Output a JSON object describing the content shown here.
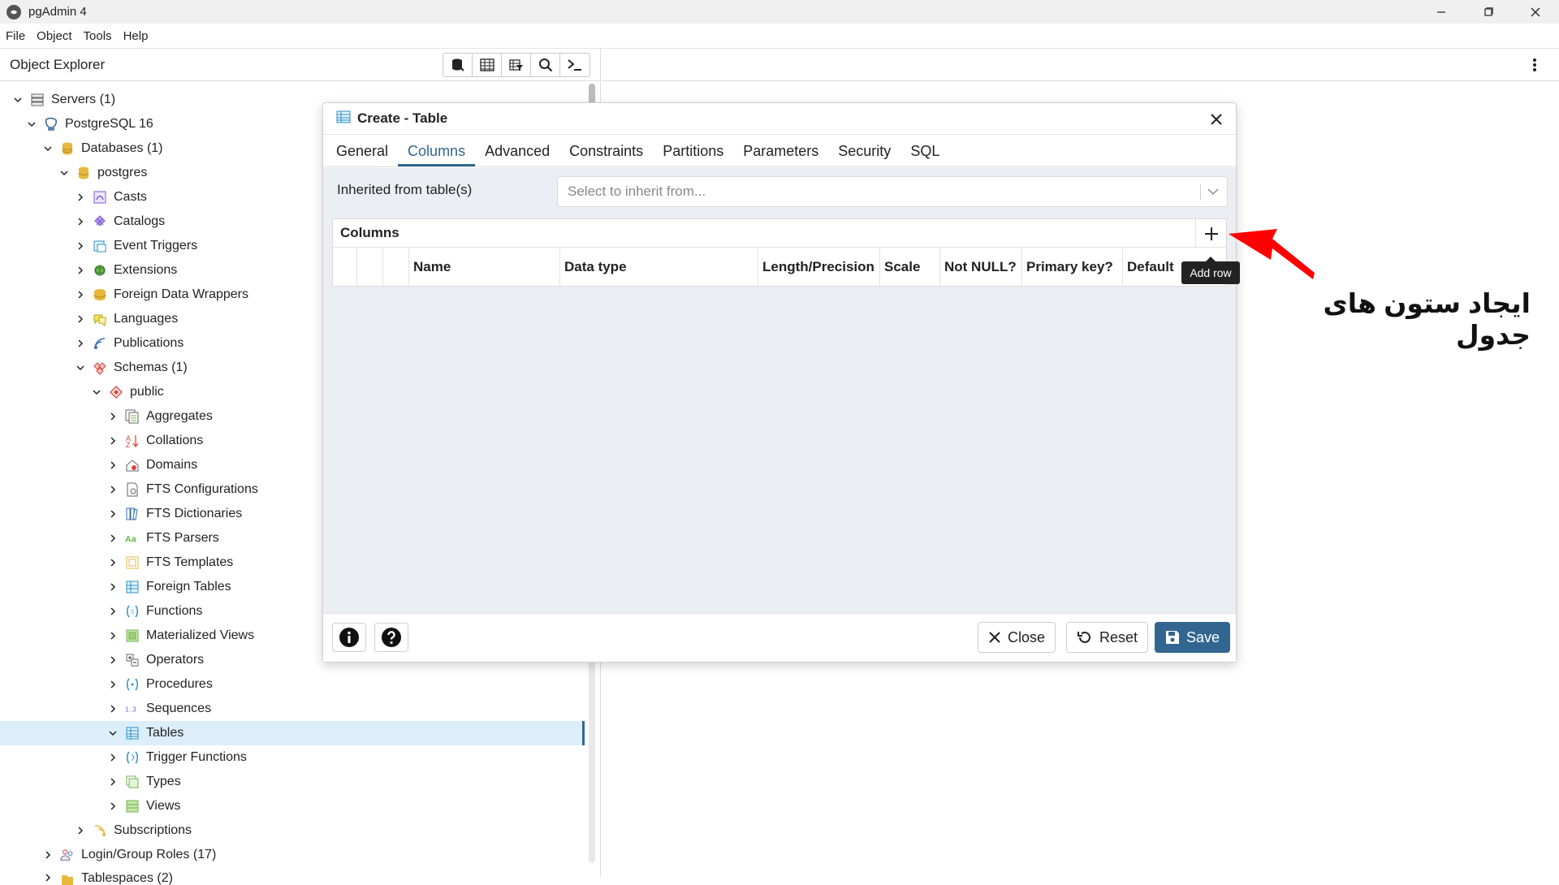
{
  "app": {
    "title": "pgAdmin 4"
  },
  "window_controls": {
    "minimize": "—",
    "maximize": "▢",
    "close": "✕"
  },
  "menu": [
    "File",
    "Object",
    "Tools",
    "Help"
  ],
  "object_explorer": {
    "title": "Object Explorer",
    "toolbar_icons": [
      "database-query-icon",
      "table-view-icon",
      "filter-table-icon",
      "search-icon",
      "terminal-icon"
    ],
    "tree": [
      {
        "label": "Servers (1)",
        "icon": "servers-icon",
        "expanded": true
      },
      {
        "label": "PostgreSQL 16",
        "icon": "elephant-icon",
        "expanded": true
      },
      {
        "label": "Databases (1)",
        "icon": "databases-icon",
        "expanded": true
      },
      {
        "label": "postgres",
        "icon": "database-icon",
        "expanded": true
      },
      {
        "label": "Casts",
        "icon": "casts-icon",
        "expanded": false
      },
      {
        "label": "Catalogs",
        "icon": "catalogs-icon",
        "expanded": false
      },
      {
        "label": "Event Triggers",
        "icon": "event-triggers-icon",
        "expanded": false
      },
      {
        "label": "Extensions",
        "icon": "extensions-icon",
        "expanded": false
      },
      {
        "label": "Foreign Data Wrappers",
        "icon": "fdw-icon",
        "expanded": false
      },
      {
        "label": "Languages",
        "icon": "languages-icon",
        "expanded": false
      },
      {
        "label": "Publications",
        "icon": "publications-icon",
        "expanded": false
      },
      {
        "label": "Schemas (1)",
        "icon": "schemas-icon",
        "expanded": true
      },
      {
        "label": "public",
        "icon": "schema-icon",
        "expanded": true
      },
      {
        "label": "Aggregates",
        "icon": "aggregates-icon",
        "expanded": false
      },
      {
        "label": "Collations",
        "icon": "collations-icon",
        "expanded": false
      },
      {
        "label": "Domains",
        "icon": "domains-icon",
        "expanded": false
      },
      {
        "label": "FTS Configurations",
        "icon": "fts-configurations-icon",
        "expanded": false
      },
      {
        "label": "FTS Dictionaries",
        "icon": "fts-dictionaries-icon",
        "expanded": false
      },
      {
        "label": "FTS Parsers",
        "icon": "fts-parsers-icon",
        "expanded": false
      },
      {
        "label": "FTS Templates",
        "icon": "fts-templates-icon",
        "expanded": false
      },
      {
        "label": "Foreign Tables",
        "icon": "foreign-tables-icon",
        "expanded": false
      },
      {
        "label": "Functions",
        "icon": "functions-icon",
        "expanded": false
      },
      {
        "label": "Materialized Views",
        "icon": "materialized-views-icon",
        "expanded": false
      },
      {
        "label": "Operators",
        "icon": "operators-icon",
        "expanded": false
      },
      {
        "label": "Procedures",
        "icon": "procedures-icon",
        "expanded": false
      },
      {
        "label": "Sequences",
        "icon": "sequences-icon",
        "expanded": false
      },
      {
        "label": "Tables",
        "icon": "tables-icon",
        "expanded": true,
        "selected": true
      },
      {
        "label": "Trigger Functions",
        "icon": "trigger-functions-icon",
        "expanded": false
      },
      {
        "label": "Types",
        "icon": "types-icon",
        "expanded": false
      },
      {
        "label": "Views",
        "icon": "views-icon",
        "expanded": false
      },
      {
        "label": "Subscriptions",
        "icon": "subscriptions-icon",
        "expanded": false
      },
      {
        "label": "Login/Group Roles (17)",
        "icon": "login-roles-icon",
        "expanded": false
      },
      {
        "label": "Tablespaces (2)",
        "icon": "tablespaces-icon",
        "expanded": false
      }
    ]
  },
  "dialog": {
    "title": "Create - Table",
    "tabs": [
      "General",
      "Columns",
      "Advanced",
      "Constraints",
      "Partitions",
      "Parameters",
      "Security",
      "SQL"
    ],
    "active_tab": "Columns",
    "inherit": {
      "label": "Inherited from table(s)",
      "placeholder": "Select to inherit from..."
    },
    "columns_panel": {
      "title": "Columns",
      "headers": [
        "",
        "",
        "",
        "Name",
        "Data type",
        "Length/Precision",
        "Scale",
        "Not NULL?",
        "Primary key?",
        "Default"
      ],
      "add_tooltip": "Add row"
    },
    "footer": {
      "close": "Close",
      "reset": "Reset",
      "save": "Save"
    }
  },
  "annotation": {
    "text": "ایجاد ستون های جدول",
    "arrow_color": "#ff0000"
  },
  "colors": {
    "accent": "#326690",
    "selected_bg": "#dbeefa",
    "body_bg": "#ebeef3"
  }
}
